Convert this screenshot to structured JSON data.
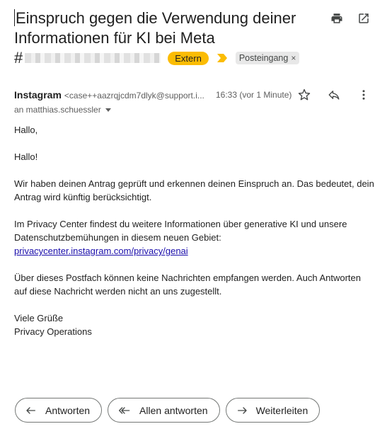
{
  "subject": {
    "line1": "Einspruch gegen die Verwendung deiner",
    "line2": "Informationen für KI bei Meta",
    "hash": "#"
  },
  "labels": {
    "extern": "Extern",
    "inbox": "Posteingang",
    "remove": "×",
    "extern_color": "#fbbc04"
  },
  "toolbar": {
    "print_icon": "print-icon",
    "open_new_window_icon": "open-in-new-window-icon"
  },
  "message": {
    "sender_name": "Instagram",
    "sender_email": "<case++aazrqjcdm7dlyk@support.i...",
    "time": "16:33 (vor 1 Minute)",
    "recipient": "an matthias.schuessler"
  },
  "body": {
    "greeting1": "Hallo,",
    "greeting2": "Hallo!",
    "para1_line1": "Wir haben deinen Antrag geprüft und erkennen deinen Einspruch an. Das bedeutet, dein",
    "para1_line2": "Antrag wird künftig berücksichtigt.",
    "para2_line1": "Im Privacy Center findest du weitere Informationen über generative KI und unsere",
    "para2_line2": "Datenschutzbemühungen in diesem neuen Gebiet:",
    "link": "privacycenter.instagram.com/privacy/genai",
    "para3_line1": "Über dieses Postfach können keine Nachrichten empfangen werden. Auch Antworten",
    "para3_line2": "auf diese Nachricht werden nicht an uns zugestellt.",
    "closing": "Viele Grüße",
    "signature": "Privacy Operations"
  },
  "actions": {
    "reply": "Antworten",
    "reply_all": "Allen antworten",
    "forward": "Weiterleiten"
  }
}
